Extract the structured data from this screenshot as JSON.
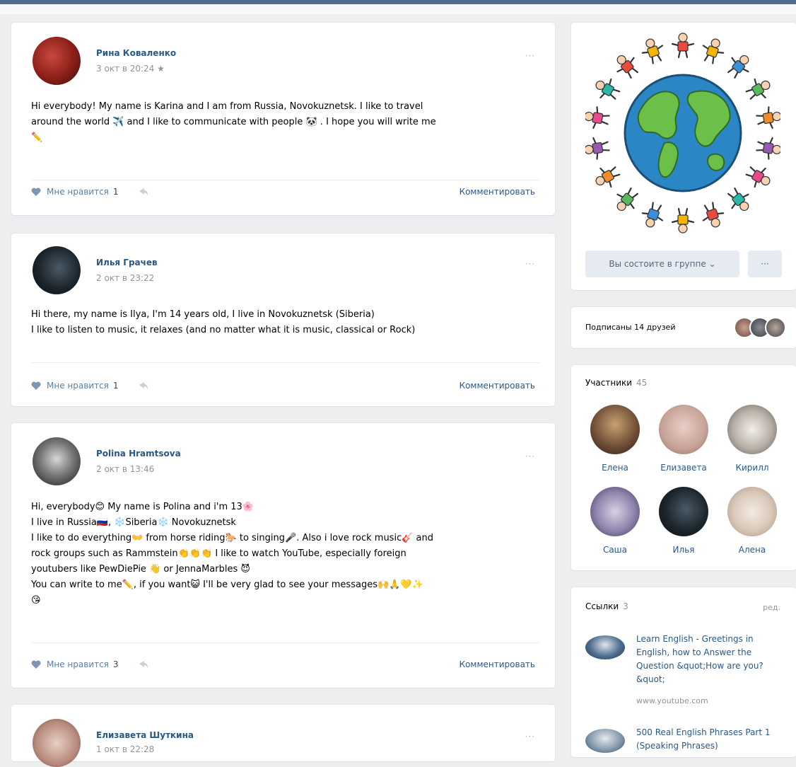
{
  "posts": [
    {
      "author": "Рина Коваленко",
      "date": "3 окт в 20:24",
      "lines": [
        "Hi everybody! My name is Karina and I am from Russia, Novokuznetsk. I like to travel",
        "around the world ✈️  and I like to communicate with people 🐼 . I hope you will write me",
        "✏️"
      ],
      "like_label": "Мне нравится",
      "like_count": "1",
      "comment_label": "Комментировать"
    },
    {
      "author": "Илья Грачев",
      "date": "2 окт в 23:22",
      "lines": [
        "Hi there, my name is Ilya, I'm 14 years old, I live in Novokuznetsk (Siberia)",
        "I like to listen to music, it relaxes (and no matter what it is music, classical or Rock)"
      ],
      "like_label": "Мне нравится",
      "like_count": "1",
      "comment_label": "Комментировать"
    },
    {
      "author": "Polina Hramtsova",
      "date": "2 окт в 13:46",
      "lines": [
        "Hi, everybody😊 My name is Polina and i'm 13🌸",
        "I live in Russia🇷🇺, ❄️Siberia❄️ Novokuznetsk",
        "I like to do everything👐 from horse riding🐎 to singing🎤. Also i love rock music🎸 and",
        "rock groups such as Rammstein👏👏👏 I like to watch YouTube, especially foreign",
        "youtubers like PewDiePie 👋 or JennaMarbles 😈",
        "You can write to me✏️, if you want😺 I'll be very glad to see your messages🙌🙏💛✨",
        "😘"
      ],
      "like_label": "Мне нравится",
      "like_count": "3",
      "comment_label": "Комментировать"
    },
    {
      "author": "Елизавета Шуткина",
      "date": "1 окт в 22:28"
    }
  ],
  "group": {
    "join_label": "Вы состоите в группе ⌄",
    "more_label": "···"
  },
  "friends": {
    "label": "Подписаны 14 друзей"
  },
  "members": {
    "title": "Участники",
    "count": "45",
    "people": [
      "Елена",
      "Елизавета",
      "Кирилл",
      "Саша",
      "Илья",
      "Алена"
    ]
  },
  "links": {
    "title": "Ссылки",
    "count": "3",
    "edit_label": "ред.",
    "items": [
      {
        "title": "Learn English - Greetings in English, how to Answer the Question &quot;How are you?&quot;",
        "url": "www.youtube.com"
      },
      {
        "title": "500 Real English Phrases Part 1 (Speaking Phrases)",
        "url": ""
      }
    ]
  },
  "colors": {
    "link_blue": "#2a5885",
    "bg": "#edeef0",
    "button_bg": "#e5ebf1",
    "meta_gray": "#939393"
  }
}
